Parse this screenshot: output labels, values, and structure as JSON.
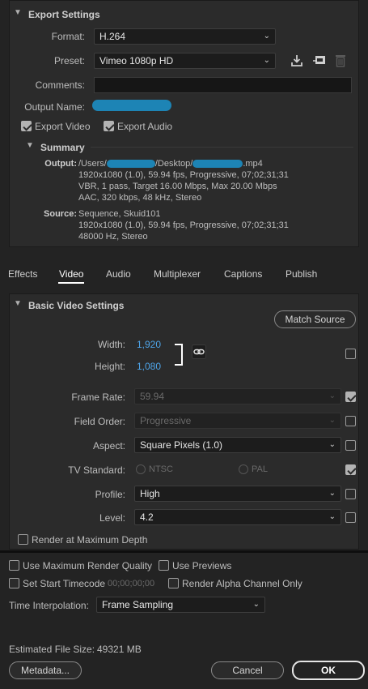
{
  "export_settings": {
    "title": "Export Settings",
    "format_label": "Format:",
    "format_value": "H.264",
    "preset_label": "Preset:",
    "preset_value": "Vimeo 1080p HD",
    "comments_label": "Comments:",
    "comments_value": "",
    "output_name_label": "Output Name:",
    "export_video_label": "Export Video",
    "export_video_checked": true,
    "export_audio_label": "Export Audio",
    "export_audio_checked": true
  },
  "summary": {
    "title": "Summary",
    "output_label": "Output:",
    "output_path_start": "/Users/",
    "output_path_mid": "/Desktop/",
    "output_path_end": ".mp4",
    "output_line2": "1920x1080 (1.0), 59.94 fps, Progressive, 07;02;31;31",
    "output_line3": "VBR, 1 pass, Target 16.00 Mbps, Max 20.00 Mbps",
    "output_line4": "AAC, 320 kbps, 48 kHz, Stereo",
    "source_label": "Source:",
    "source_line1": "Sequence, Skuid101",
    "source_line2": "1920x1080 (1.0), 59.94 fps, Progressive, 07;02;31;31",
    "source_line3": "48000 Hz, Stereo"
  },
  "tabs": [
    "Effects",
    "Video",
    "Audio",
    "Multiplexer",
    "Captions",
    "Publish"
  ],
  "active_tab": "Video",
  "basic_video": {
    "title": "Basic Video Settings",
    "match_source_label": "Match Source",
    "width_label": "Width:",
    "width_value": "1,920",
    "height_label": "Height:",
    "height_value": "1,080",
    "frame_rate_label": "Frame Rate:",
    "frame_rate_value": "59.94",
    "field_order_label": "Field Order:",
    "field_order_value": "Progressive",
    "aspect_label": "Aspect:",
    "aspect_value": "Square Pixels (1.0)",
    "tv_standard_label": "TV Standard:",
    "tv_ntsc_label": "NTSC",
    "tv_pal_label": "PAL",
    "profile_label": "Profile:",
    "profile_value": "High",
    "level_label": "Level:",
    "level_value": "4.2",
    "render_max_depth_label": "Render at Maximum Depth"
  },
  "bottom": {
    "use_max_render_quality_label": "Use Maximum Render Quality",
    "use_previews_label": "Use Previews",
    "set_start_timecode_label": "Set Start Timecode",
    "start_timecode_value": "00;00;00;00",
    "render_alpha_label": "Render Alpha Channel Only",
    "time_interpolation_label": "Time Interpolation:",
    "time_interpolation_value": "Frame Sampling",
    "estimated_size_label": "Estimated File Size:",
    "estimated_size_value": "49321 MB",
    "metadata_label": "Metadata...",
    "cancel_label": "Cancel",
    "ok_label": "OK"
  },
  "colors": {
    "accent_blue": "#4ea4e8",
    "redaction": "#1d84b5",
    "background": "#232323",
    "panel": "#2b2b2b"
  }
}
